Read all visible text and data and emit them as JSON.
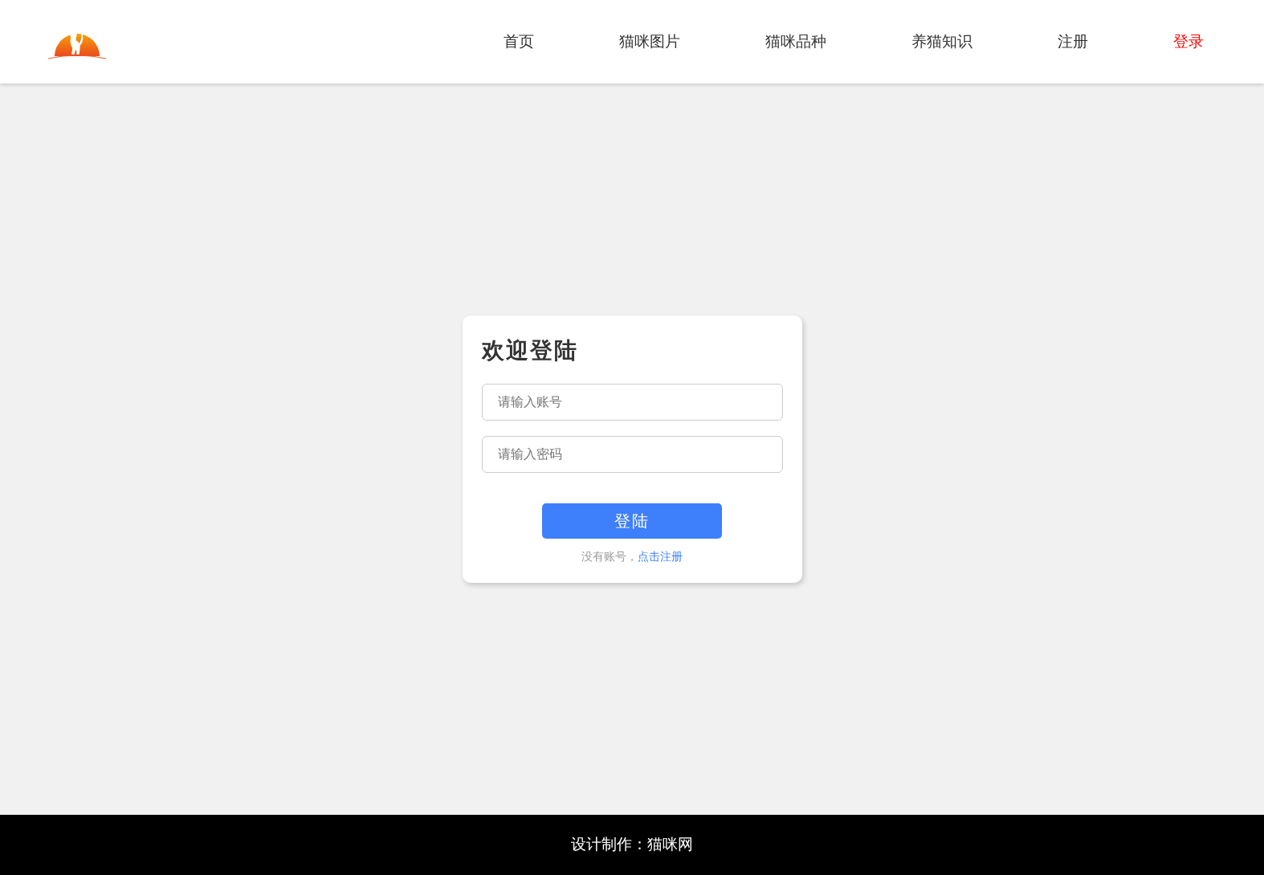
{
  "nav": [
    {
      "label": "首页",
      "selected": false
    },
    {
      "label": "猫咪图片",
      "selected": false
    },
    {
      "label": "猫咪品种",
      "selected": false
    },
    {
      "label": "养猫知识",
      "selected": false
    },
    {
      "label": "注册",
      "selected": false
    },
    {
      "label": "登录",
      "selected": true
    }
  ],
  "login": {
    "title": "欢迎登陆",
    "account": {
      "placeholder": "请输入账号"
    },
    "password": {
      "placeholder": "请输入密码"
    },
    "button": "登陆",
    "hint": "没有账号，",
    "register_link": "点击注册"
  },
  "footer": "设计制作：猫咪网"
}
